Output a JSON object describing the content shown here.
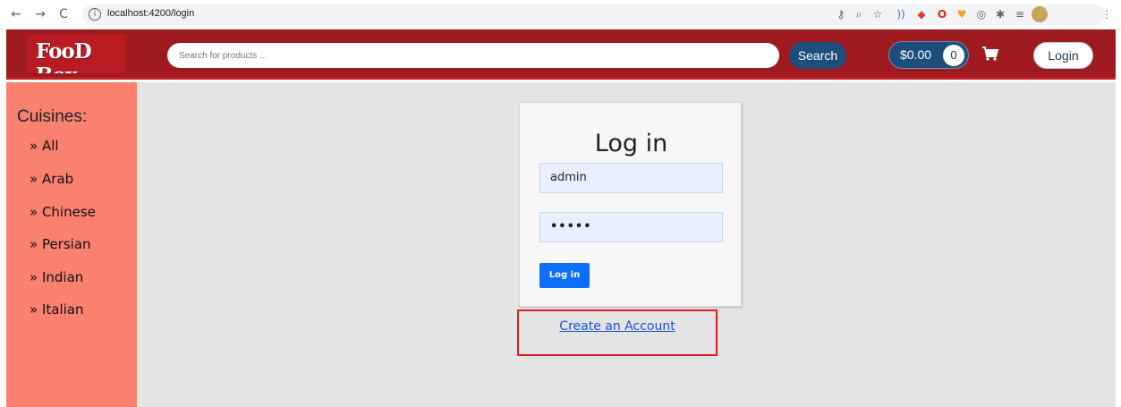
{
  "browser": {
    "back": "←",
    "forward": "→",
    "reload": "C",
    "url": "localhost:4200/login"
  },
  "header": {
    "logo_text": "FooD Box",
    "search_placeholder": "Search for products ...",
    "search_button": "Search",
    "cart_total": "$0.00",
    "cart_count": "0",
    "login_button": "Login"
  },
  "sidebar": {
    "title": "Cuisines:",
    "items": [
      {
        "label": "» All"
      },
      {
        "label": "» Arab"
      },
      {
        "label": "» Chinese"
      },
      {
        "label": "» Persian"
      },
      {
        "label": "» Indian"
      },
      {
        "label": "» Italian"
      }
    ]
  },
  "login": {
    "title": "Log in",
    "username_value": "admin",
    "password_value": "•••••",
    "submit_button": "Log in",
    "create_account_link": "Create an Account"
  },
  "colors": {
    "header_bg": "#9e1a1f",
    "sidebar_bg": "#fa8070",
    "main_bg": "#e4e4e4",
    "primary_button": "#0d6efd",
    "highlight_border": "#e01e1e"
  }
}
